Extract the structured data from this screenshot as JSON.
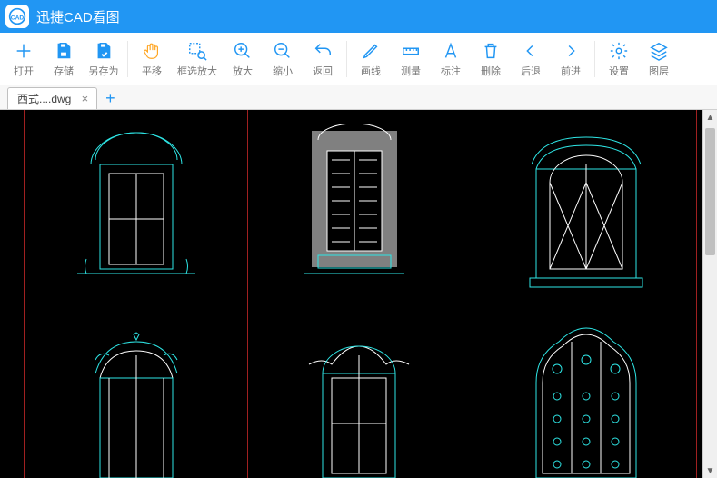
{
  "title": "迅捷CAD看图",
  "logo_text": "CAD",
  "toolbar": {
    "open": "打开",
    "save": "存储",
    "saveas": "另存为",
    "pan": "平移",
    "zoombox": "框选放大",
    "zoomin": "放大",
    "zoomout": "缩小",
    "return": "返回",
    "drawline": "画线",
    "measure": "测量",
    "annotate": "标注",
    "delete": "删除",
    "back": "后退",
    "forward": "前进",
    "settings": "设置",
    "layers": "图层"
  },
  "tab": {
    "name": "西式....dwg"
  },
  "colors": {
    "accent": "#2196f3",
    "cad_cyan": "#2ee6e6",
    "cad_grid": "#a02020",
    "cad_bg": "#000000"
  }
}
